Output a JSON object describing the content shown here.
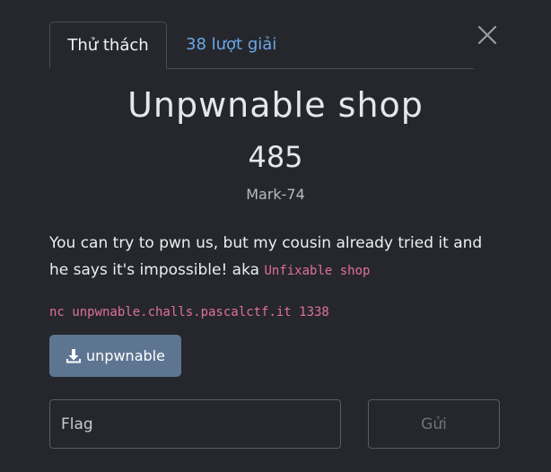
{
  "tabs": {
    "challenge": "Thử thách",
    "solves": "38 lượt giải"
  },
  "challenge": {
    "title": "Unpwnable shop",
    "points": "485",
    "author": "Mark-74",
    "description_text": "You can try to pwn us, but my cousin already tried it and he says it's impossible! aka ",
    "description_code": "Unfixable shop",
    "connection": "nc unpwnable.challs.pascalctf.it 1338"
  },
  "download": {
    "label": "unpwnable",
    "icon": "download-icon"
  },
  "flag": {
    "placeholder": "Flag",
    "value": ""
  },
  "submit": {
    "label": "Gửi"
  },
  "close": {
    "icon": "close-icon"
  },
  "colors": {
    "background": "#25272d",
    "link": "#6ca7e8",
    "code": "#e0709c",
    "download_button": "#5e7592"
  }
}
